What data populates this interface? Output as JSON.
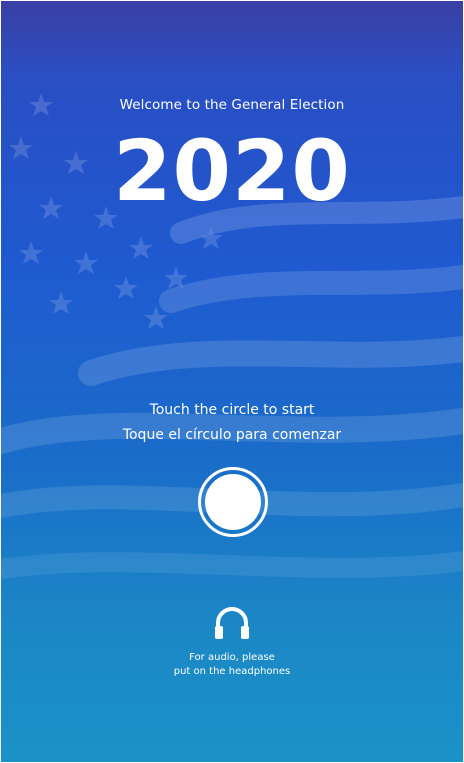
{
  "welcome": {
    "title": "Welcome to the General Election",
    "year": "2020"
  },
  "instructions": {
    "english": "Touch the circle to start",
    "spanish": "Toque el círculo para comenzar"
  },
  "start_button": {
    "icon": "circle-icon"
  },
  "audio": {
    "icon": "headphones-icon",
    "line1": "For audio, please",
    "line2": "put on the headphones"
  },
  "colors": {
    "background_top": "#3a3fa4",
    "background_mid": "#1f5ad0",
    "background_bottom": "#1a92c7",
    "text": "#ffffff"
  }
}
